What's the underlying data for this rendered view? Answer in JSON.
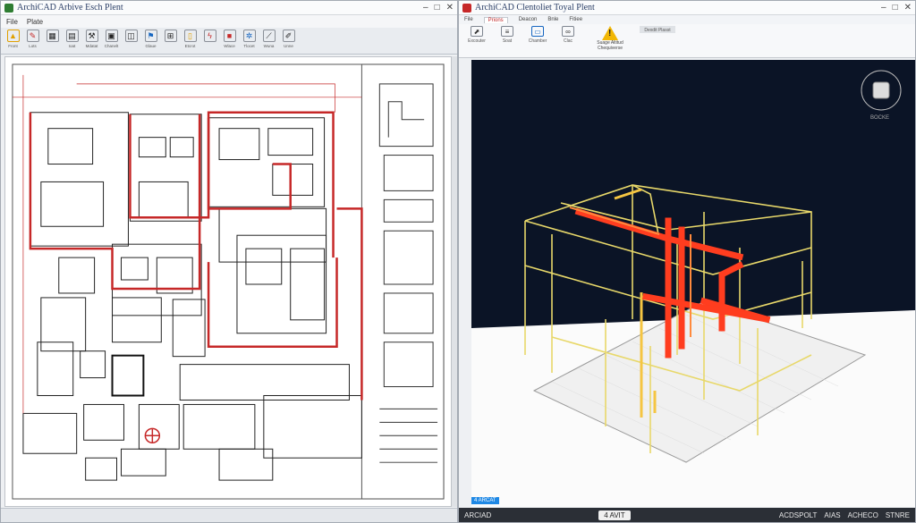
{
  "left_window": {
    "title": "ArchiCAD Arbive Esch Plent",
    "menu": [
      "File",
      "Plate"
    ],
    "ribbon": [
      {
        "icon": "warning-icon",
        "label": "Front"
      },
      {
        "icon": "pencil-icon",
        "label": "Lots"
      },
      {
        "icon": "grid-icon",
        "label": ""
      },
      {
        "icon": "table-icon",
        "label": "Ioat"
      },
      {
        "icon": "tools-icon",
        "label": "Mdatat"
      },
      {
        "icon": "image-icon",
        "label": "Chanelt"
      },
      {
        "icon": "box-icon",
        "label": ""
      },
      {
        "icon": "flag-icon",
        "label": "Glaue"
      },
      {
        "icon": "layout-icon",
        "label": ""
      },
      {
        "icon": "page-icon",
        "label": "Etcrot"
      },
      {
        "icon": "bolt-icon",
        "label": ""
      },
      {
        "icon": "stop-icon",
        "label": "Wlace"
      },
      {
        "icon": "snowflake-icon",
        "label": "Tlocet"
      },
      {
        "icon": "measure-icon",
        "label": "Wuna"
      },
      {
        "icon": "brush-icon",
        "label": "Unne"
      }
    ]
  },
  "right_window": {
    "title": "ArchiCAD Clentoliet Toyal Plent",
    "tabs": [
      "File",
      "Prions",
      "Deacon",
      "Bnle",
      "Fitiee"
    ],
    "active_tab": "Prions",
    "ribbon": [
      {
        "icon": "cursor-icon",
        "label": "Excouter"
      },
      {
        "icon": "stack-icon",
        "label": "Soat"
      },
      {
        "icon": "window-icon",
        "label": "Chamber"
      },
      {
        "icon": "link-icon",
        "label": "Clac"
      }
    ],
    "warning": {
      "label": "Suage Altitud Chequiverse"
    },
    "side_label": "Dexdit Plasst",
    "status": {
      "app": "ARCIAD",
      "version": "4 AVIT",
      "right_items": [
        "ACDSPOLT",
        "AIAS",
        "ACHECO",
        "STNRE"
      ]
    },
    "badge": "4 ARCAT",
    "cube_label": "BOCKE"
  }
}
